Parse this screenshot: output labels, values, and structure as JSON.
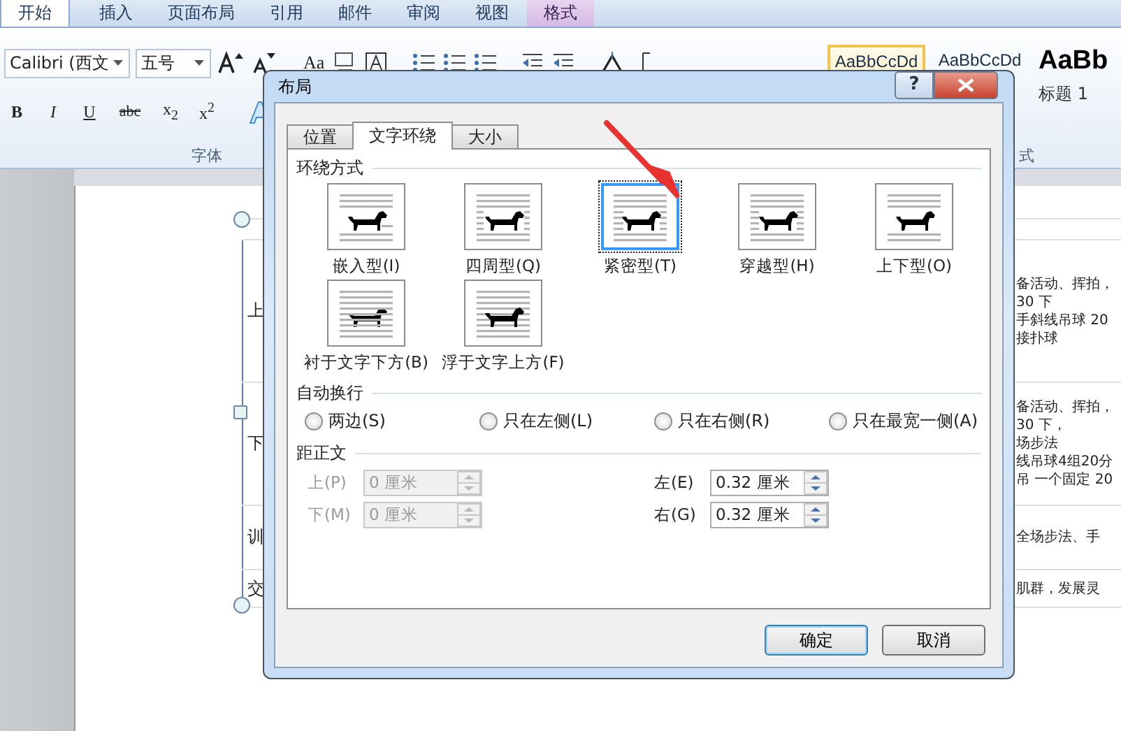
{
  "ribbon": {
    "tabs": [
      {
        "label": "开始",
        "selected": true,
        "kind": "normal"
      },
      {
        "label": "插入",
        "selected": false,
        "kind": "normal"
      },
      {
        "label": "页面布局",
        "selected": false,
        "kind": "normal"
      },
      {
        "label": "引用",
        "selected": false,
        "kind": "normal"
      },
      {
        "label": "邮件",
        "selected": false,
        "kind": "normal"
      },
      {
        "label": "审阅",
        "selected": false,
        "kind": "normal"
      },
      {
        "label": "视图",
        "selected": false,
        "kind": "normal"
      },
      {
        "label": "格式",
        "selected": false,
        "kind": "contextual"
      }
    ],
    "font_name": "Calibri (西文",
    "font_size": "五号",
    "change_case": "Aa",
    "format_buttons": [
      "B",
      "I",
      "U",
      "abc",
      "x$_{2}$",
      "x$^{2}$"
    ],
    "styles": [
      {
        "sample": "AaBbCcDd",
        "selected": true,
        "kind": "normal"
      },
      {
        "sample": "AaBbCcDd",
        "selected": false,
        "kind": "normal"
      },
      {
        "sample": "AaBb",
        "selected": false,
        "kind": "heading",
        "caption": "标题 1"
      }
    ],
    "group_labels": [
      "字体",
      "式"
    ]
  },
  "document": {
    "rows": [
      {
        "left": "上",
        "right": [
          "备活动、挥拍，",
          "30 下",
          "手斜线吊球 20",
          "接扑球"
        ]
      },
      {
        "left": "下",
        "right": [
          "备活动、挥拍，",
          "30 下，",
          "场步法",
          "线吊球4组20分",
          "吊 一个固定 20"
        ]
      },
      {
        "left": "训",
        "right": [
          "全场步法、手"
        ]
      },
      {
        "left": "交",
        "right": [
          "肌群，发展灵"
        ]
      }
    ]
  },
  "dialog": {
    "title": "布局",
    "help": "?",
    "tabs": [
      {
        "label": "位置",
        "selected": false
      },
      {
        "label": "文字环绕",
        "selected": true
      },
      {
        "label": "大小",
        "selected": false
      }
    ],
    "wrap_title": "环绕方式",
    "wrap_options": [
      {
        "label": "嵌入型(I)",
        "kind": "inline",
        "selected": false
      },
      {
        "label": "四周型(Q)",
        "kind": "square",
        "selected": false
      },
      {
        "label": "紧密型(T)",
        "kind": "tight",
        "selected": true
      },
      {
        "label": "穿越型(H)",
        "kind": "through",
        "selected": false
      },
      {
        "label": "上下型(O)",
        "kind": "topbottom",
        "selected": false
      },
      {
        "label": "衬于文字下方(B)",
        "kind": "behind",
        "selected": false
      },
      {
        "label": "浮于文字上方(F)",
        "kind": "front",
        "selected": false
      }
    ],
    "wrap_text_title": "自动换行",
    "wrap_text": [
      {
        "label": "两边(S)",
        "selected": false
      },
      {
        "label": "只在左侧(L)",
        "selected": false
      },
      {
        "label": "只在右侧(R)",
        "selected": false
      },
      {
        "label": "只在最宽一侧(A)",
        "selected": false
      }
    ],
    "distance_title": "距正文",
    "distance": [
      {
        "label": "上(P)",
        "value": "0 厘米",
        "disabled": true
      },
      {
        "label": "左(E)",
        "value": "0.32 厘米",
        "disabled": false
      },
      {
        "label": "下(M)",
        "value": "0 厘米",
        "disabled": true
      },
      {
        "label": "右(G)",
        "value": "0.32 厘米",
        "disabled": false
      }
    ],
    "buttons": [
      {
        "label": "确定",
        "kind": "default"
      },
      {
        "label": "取消",
        "kind": "normal"
      }
    ]
  }
}
